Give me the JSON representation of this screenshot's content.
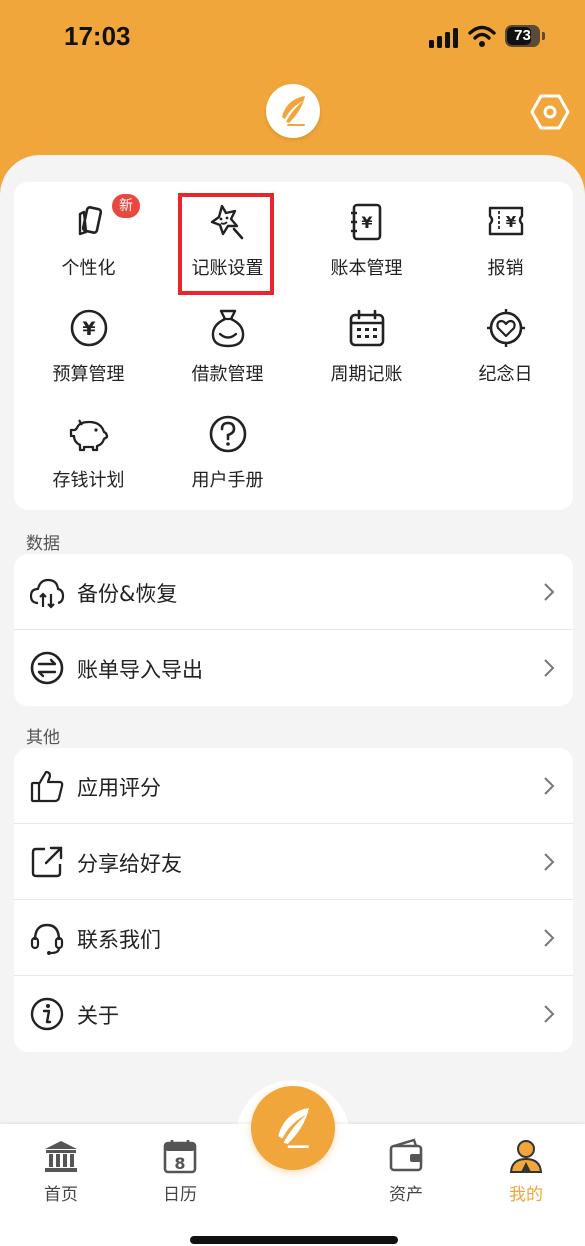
{
  "status": {
    "time": "17:03",
    "battery": "73"
  },
  "grid": {
    "badge": "新",
    "items": [
      {
        "label": "个性化",
        "icon": "palette-cards-icon"
      },
      {
        "label": "记账设置",
        "icon": "star-wand-icon"
      },
      {
        "label": "账本管理",
        "icon": "ledger-icon"
      },
      {
        "label": "报销",
        "icon": "receipt-icon"
      },
      {
        "label": "预算管理",
        "icon": "yen-circle-icon"
      },
      {
        "label": "借款管理",
        "icon": "money-bag-icon"
      },
      {
        "label": "周期记账",
        "icon": "calendar-icon"
      },
      {
        "label": "纪念日",
        "icon": "heart-target-icon"
      },
      {
        "label": "存钱计划",
        "icon": "piggy-bank-icon"
      },
      {
        "label": "用户手册",
        "icon": "help-circle-icon"
      }
    ]
  },
  "data_section": {
    "title": "数据",
    "items": [
      {
        "label": "备份&恢复",
        "icon": "cloud-sync-icon"
      },
      {
        "label": "账单导入导出",
        "icon": "transfer-icon"
      }
    ]
  },
  "other_section": {
    "title": "其他",
    "items": [
      {
        "label": "应用评分",
        "icon": "thumbs-up-icon"
      },
      {
        "label": "分享给好友",
        "icon": "share-icon"
      },
      {
        "label": "联系我们",
        "icon": "headset-icon"
      },
      {
        "label": "关于",
        "icon": "info-icon"
      }
    ]
  },
  "tabbar": {
    "tabs": [
      {
        "label": "首页",
        "icon": "bank-icon"
      },
      {
        "label": "日历",
        "icon": "calendar-8-icon",
        "day": "8"
      },
      {
        "label": "资产",
        "icon": "wallet-icon"
      },
      {
        "label": "我的",
        "icon": "user-icon",
        "active": true
      }
    ]
  },
  "colors": {
    "accent": "#f0a63a",
    "badge": "#e8483e",
    "highlight": "#e8262c",
    "background": "#f4f4f4"
  }
}
